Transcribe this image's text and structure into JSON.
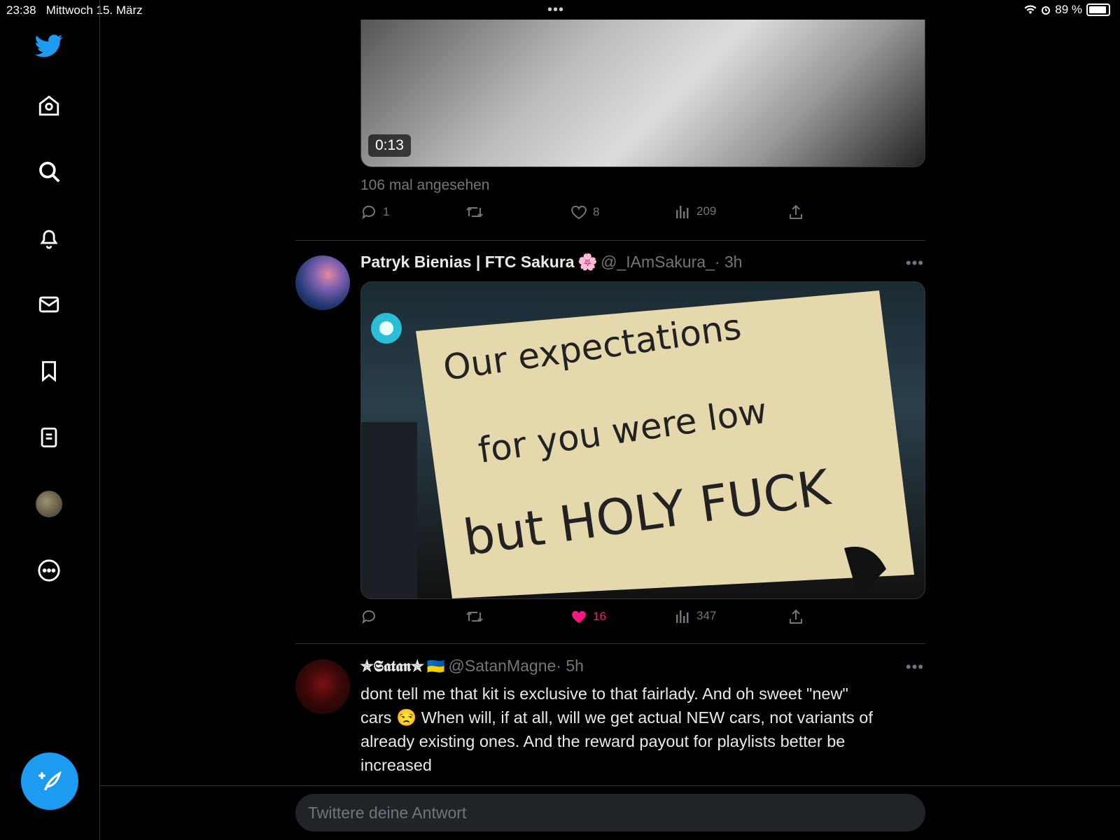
{
  "status_bar": {
    "time": "23:38",
    "date": "Mittwoch 15. März",
    "battery": "89 %"
  },
  "colors": {
    "accent": "#1d9bf0",
    "like_active": "#f91880",
    "muted": "#71767b",
    "background": "#000000"
  },
  "sidebar": {
    "items": [
      {
        "icon": "twitter-logo-icon"
      },
      {
        "icon": "home-icon"
      },
      {
        "icon": "search-icon"
      },
      {
        "icon": "bell-icon"
      },
      {
        "icon": "mail-icon"
      },
      {
        "icon": "bookmark-icon"
      },
      {
        "icon": "list-icon"
      },
      {
        "icon": "profile-avatar"
      },
      {
        "icon": "more-circle-icon"
      }
    ],
    "compose_icon": "compose-tweet-icon"
  },
  "tweet1": {
    "video_duration": "0:13",
    "views_text": "106 mal angesehen",
    "replies": "1",
    "retweets": "",
    "likes": "8",
    "views": "209"
  },
  "tweet2": {
    "name": "Patryk Bienias | FTC Sakura",
    "emoji": "🌸",
    "handle": "@_IAmSakura_",
    "time": "· 3h",
    "image_sign_text": [
      "Our expectations",
      "for you were low",
      "but HOLY FUCK"
    ],
    "replies": "",
    "retweets": "",
    "likes": "16",
    "views": "347",
    "liked": true
  },
  "tweet3": {
    "name": "✯𝕾𝖆𝖙𝖆𝖓✯",
    "flag": "🇺🇦",
    "handle": "@SatanMagne",
    "time": "· 5h",
    "text_line1": "dont tell me that kit is exclusive to that fairlady. And oh sweet \"new\"",
    "text_line2_a": "cars",
    "text_line2_emoji": "😒",
    "text_line2_b": "When will, if at all, will we get actual NEW cars, not variants of",
    "text_line3": "already existing ones. And the reward payout for playlists better be",
    "text_line4": "increased"
  },
  "reply_box": {
    "placeholder": "Twittere deine Antwort"
  }
}
